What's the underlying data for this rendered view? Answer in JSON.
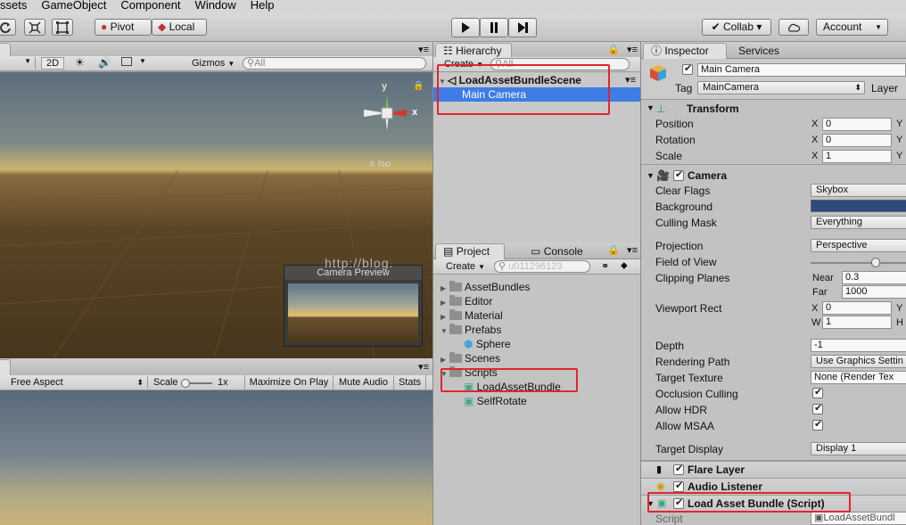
{
  "menu": [
    "ssets",
    "GameObject",
    "Component",
    "Window",
    "Help"
  ],
  "toolbar": {
    "pivot": "Pivot",
    "local": "Local",
    "collab": "Collab ▾",
    "account": "Account",
    "play_icon": "play-icon",
    "pause_icon": "pause-icon",
    "step_icon": "step-icon"
  },
  "scene": {
    "mode_2d": "2D",
    "gizmos": "Gizmos",
    "search_placeholder": "All",
    "iso": "Iso",
    "axis_y": "y",
    "axis_x": "x",
    "camera_preview_title": "Camera Preview",
    "watermark": "http://blog."
  },
  "game": {
    "aspect": "Free Aspect",
    "scale_label": "Scale",
    "scale_value": "1x",
    "maximize": "Maximize On Play",
    "mute": "Mute Audio",
    "stats": "Stats"
  },
  "hierarchy": {
    "tab": "Hierarchy",
    "create": "Create",
    "search_placeholder": "All",
    "scene_name": "LoadAssetBundleScene",
    "item": "Main Camera"
  },
  "project": {
    "tab_project": "Project",
    "tab_console": "Console",
    "create": "Create",
    "search_watermark": "u011296123",
    "items": [
      {
        "label": "AssetBundles",
        "indent": 0,
        "type": "folder"
      },
      {
        "label": "Editor",
        "indent": 0,
        "type": "folder"
      },
      {
        "label": "Material",
        "indent": 0,
        "type": "folder"
      },
      {
        "label": "Prefabs",
        "indent": 0,
        "type": "folder",
        "open": true
      },
      {
        "label": "Sphere",
        "indent": 1,
        "type": "prefab"
      },
      {
        "label": "Scenes",
        "indent": 0,
        "type": "folder"
      },
      {
        "label": "Scripts",
        "indent": 0,
        "type": "folder",
        "open": true
      },
      {
        "label": "LoadAssetBundle",
        "indent": 1,
        "type": "script"
      },
      {
        "label": "SelfRotate",
        "indent": 1,
        "type": "script"
      }
    ]
  },
  "inspector": {
    "tab": "Inspector",
    "tab_services": "Services",
    "object_name": "Main Camera",
    "tag_label": "Tag",
    "tag_value": "MainCamera",
    "layer_label": "Layer",
    "transform": {
      "title": "Transform",
      "position_label": "Position",
      "rotation_label": "Rotation",
      "scale_label": "Scale",
      "x_label": "X",
      "y_label": "Y",
      "position_x": "0",
      "rotation_x": "0",
      "scale_x": "1"
    },
    "camera": {
      "title": "Camera",
      "clear_flags_label": "Clear Flags",
      "clear_flags_value": "Skybox",
      "background_label": "Background",
      "background_color": "#2c4a7a",
      "culling_mask_label": "Culling Mask",
      "culling_mask_value": "Everything",
      "projection_label": "Projection",
      "projection_value": "Perspective",
      "fov_label": "Field of View",
      "fov_value": 0.68,
      "clipping_label": "Clipping Planes",
      "near_label": "Near",
      "near_value": "0.3",
      "far_label": "Far",
      "far_value": "1000",
      "viewport_label": "Viewport Rect",
      "vx_label": "X",
      "vx_value": "0",
      "vy_label": "Y",
      "vw_label": "W",
      "vw_value": "1",
      "vh_label": "H",
      "depth_label": "Depth",
      "depth_value": "-1",
      "rendering_path_label": "Rendering Path",
      "rendering_path_value": "Use Graphics Settin",
      "target_texture_label": "Target Texture",
      "target_texture_value": "None (Render Tex",
      "occlusion_label": "Occlusion Culling",
      "hdr_label": "Allow HDR",
      "msaa_label": "Allow MSAA",
      "target_display_label": "Target Display",
      "target_display_value": "Display 1"
    },
    "flare_layer": "Flare Layer",
    "audio_listener": "Audio Listener",
    "script_component": "Load Asset Bundle (Script)",
    "script_label": "Script",
    "script_value": "LoadAssetBundl"
  },
  "colors": {
    "highlight": "#e0262b",
    "selection": "#3e7ce6"
  }
}
